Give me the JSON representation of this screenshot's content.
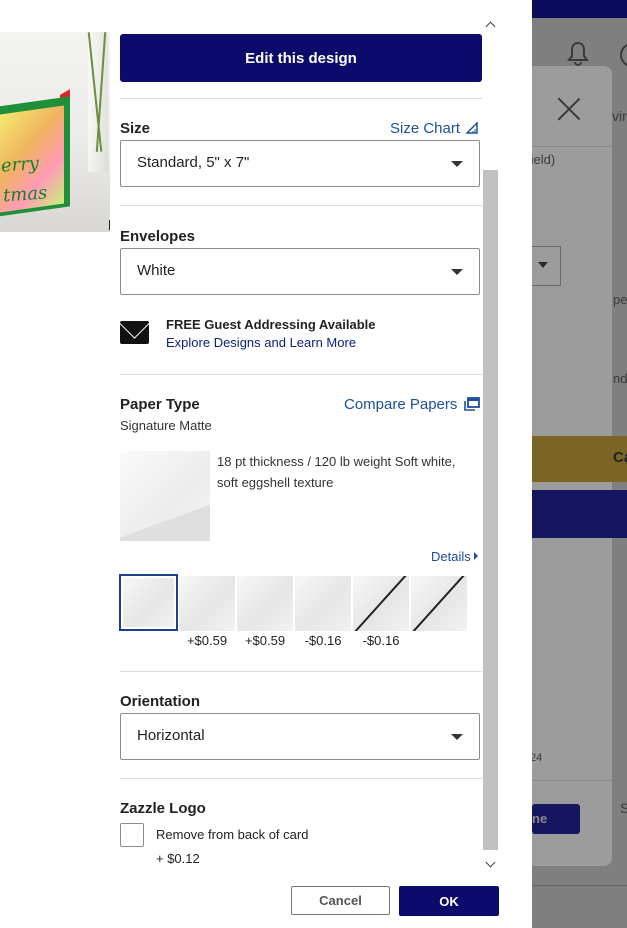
{
  "panel": {
    "edit_design_label": "Edit this design",
    "size": {
      "label": "Size",
      "chart_link": "Size Chart",
      "selected": "Standard, 5\" x 7\""
    },
    "envelopes": {
      "label": "Envelopes",
      "selected": "White"
    },
    "guest_addressing": {
      "title": "FREE Guest Addressing Available",
      "link": "Explore Designs and Learn More",
      "icon": "envelope-icon"
    },
    "paper_type": {
      "label": "Paper Type",
      "compare_link": "Compare Papers",
      "selected_name": "Signature Matte",
      "description": "18 pt thickness / 120 lb weight Soft white, soft eggshell texture",
      "details_link": "Details",
      "swatch_prices": [
        "+$0.59",
        "+$0.59",
        "-$0.16",
        "-$0.16"
      ]
    },
    "orientation": {
      "label": "Orientation",
      "selected": "Horizontal"
    },
    "logo": {
      "label": "Zazzle Logo",
      "checkbox_label": "Remove from back of card",
      "checkbox_checked": false,
      "price": "+ $0.12"
    },
    "footer": {
      "cancel_label": "Cancel",
      "ok_label": "OK"
    }
  },
  "preview": {
    "card_text_line1": "erry",
    "card_text_line2": "tmas"
  },
  "background": {
    "text_field": "field)",
    "text_vin": "vin",
    "text_pe": "pe",
    "text_nd": "nd",
    "text_ca": "Ca",
    "text_24": "24",
    "text_done": "ne",
    "text_s": "S"
  },
  "colors": {
    "primary_navy": "#0b0b6b",
    "link_blue": "#1f4fa0",
    "selected_swatch_border": "#1c3f8e"
  }
}
